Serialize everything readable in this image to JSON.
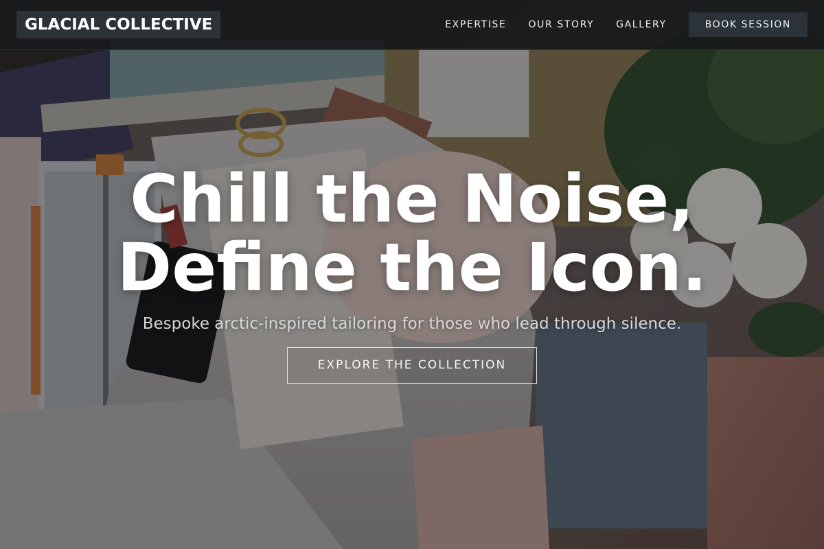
{
  "header": {
    "logo": "GLACIAL COLLECTIVE",
    "nav": [
      "EXPERTISE",
      "OUR STORY",
      "GALLERY"
    ],
    "cta_label": "BOOK SESSION"
  },
  "hero": {
    "headline_line1": "Chill the Noise,",
    "headline_line2": "Define the Icon.",
    "subheadline": "Bespoke arctic-inspired tailoring for those who lead through silence.",
    "cta_label": "EXPLORE THE COLLECTION",
    "background_image": "flat-lay of craft supplies, paper cutter, scissors, white fabric, white roses and a notebook"
  },
  "colors": {
    "header_bg": "#18191b",
    "button_bg": "#2b3238",
    "text_primary": "#ffffff",
    "text_secondary": "#d8d8d8"
  }
}
